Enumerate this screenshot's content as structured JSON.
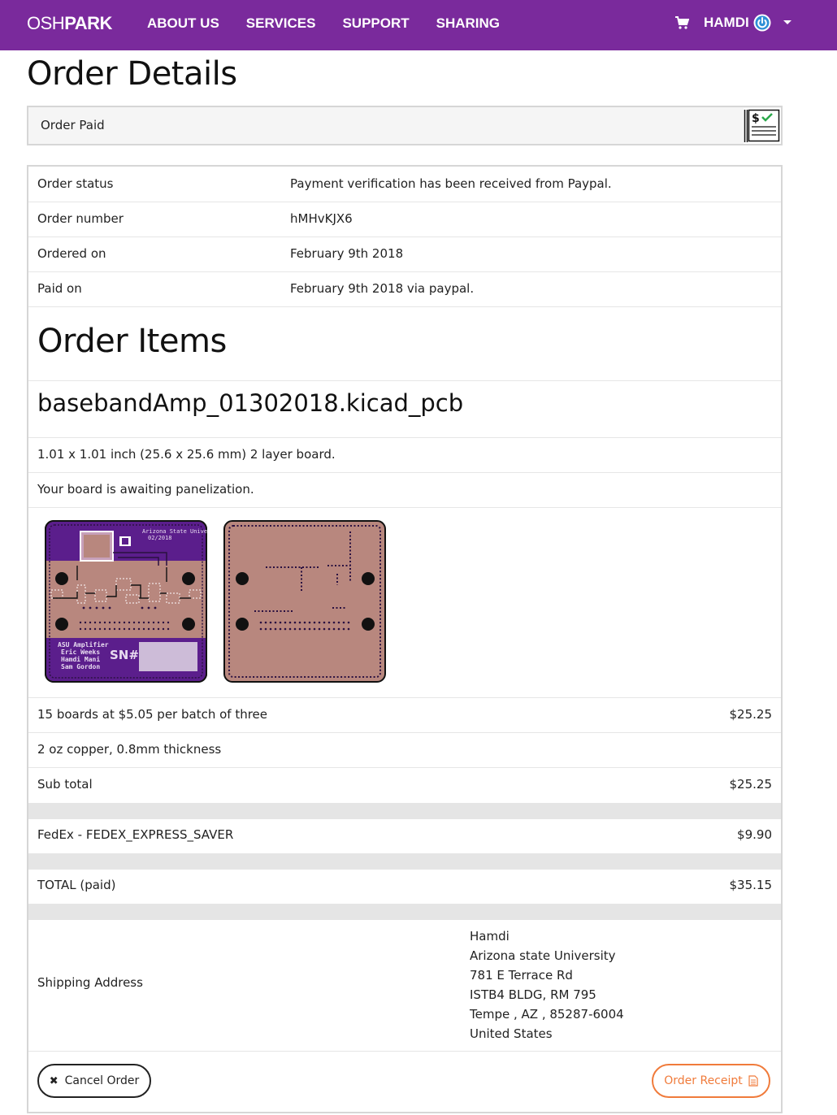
{
  "nav": {
    "logo_light": "OSH",
    "logo_bold": "PARK",
    "items": [
      "ABOUT US",
      "SERVICES",
      "SUPPORT",
      "SHARING"
    ],
    "user": "HAMDI",
    "icons": [
      "cart-icon",
      "power-icon",
      "caret-down-icon"
    ]
  },
  "page_title": "Order Details",
  "status_bar": {
    "text": "Order Paid",
    "icon": "paid-check-icon"
  },
  "details": [
    {
      "label": "Order status",
      "value": "Payment verification has been received from Paypal."
    },
    {
      "label": "Order number",
      "value": "hMHvKJX6"
    },
    {
      "label": "Ordered on",
      "value": "February 9th 2018"
    },
    {
      "label": "Paid on",
      "value": "February 9th 2018 via paypal."
    }
  ],
  "items_title": "Order Items",
  "board": {
    "name": "basebandAmp_01302018.kicad_pcb",
    "size": "1.01 x 1.01 inch (25.6 x 25.6 mm) 2 layer board.",
    "status": "Your board is awaiting panelization.",
    "silkscreen": {
      "top_right": "Arizona State University",
      "date": "02/2018",
      "credits": "ASU Amplifier\nEric Weeks\nHamdi Mani\nSam Gordon",
      "sn": "SN#"
    }
  },
  "pricing": {
    "boards": {
      "label": "15 boards at $5.05 per batch of three",
      "amount": "$25.25"
    },
    "options": {
      "label": "2 oz copper, 0.8mm thickness"
    },
    "subtotal": {
      "label": "Sub total",
      "amount": "$25.25"
    },
    "shipping": {
      "label": "FedEx - FEDEX_EXPRESS_SAVER",
      "amount": "$9.90"
    },
    "total": {
      "label": "TOTAL (paid)",
      "amount": "$35.15"
    }
  },
  "shipping_address": {
    "label": "Shipping Address",
    "lines": [
      "Hamdi",
      "Arizona state University",
      "781 E Terrace Rd",
      "ISTB4 BLDG, RM 795",
      "Tempe , AZ , 85287-6004",
      "United States"
    ]
  },
  "actions": {
    "cancel": "Cancel Order",
    "receipt": "Order Receipt"
  },
  "colors": {
    "nav_bg": "#7a2a9c",
    "receipt_accent": "#f07b3b",
    "pcb_purple": "#5b1e8c",
    "pcb_copper": "#b8877e"
  }
}
